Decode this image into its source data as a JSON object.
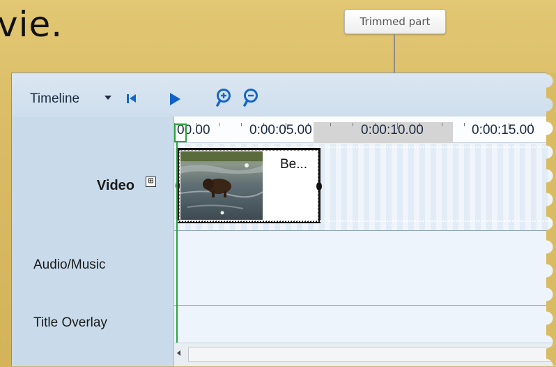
{
  "slide": {
    "partial_heading": "vie."
  },
  "callout": {
    "text": "Trimmed part"
  },
  "toolbar": {
    "view_label": "Timeline",
    "icons": [
      "chevron-down-icon",
      "rewind-icon",
      "play-icon",
      "zoom-in-icon",
      "zoom-out-icon"
    ]
  },
  "ruler": {
    "labels": [
      "00.00",
      "0:00:05.00",
      "0:00:10.00",
      "0:00:15.00"
    ]
  },
  "tracks": {
    "video": {
      "label": "Video",
      "expand_symbol": "⊞"
    },
    "audio": {
      "label": "Audio/Music"
    },
    "title": {
      "label": "Title Overlay"
    }
  },
  "clip": {
    "title": "Be..."
  },
  "colors": {
    "accent": "#1566c8",
    "playhead": "#2ea341",
    "panel": "#c9dbea",
    "slide_background": "#d9bb63"
  }
}
